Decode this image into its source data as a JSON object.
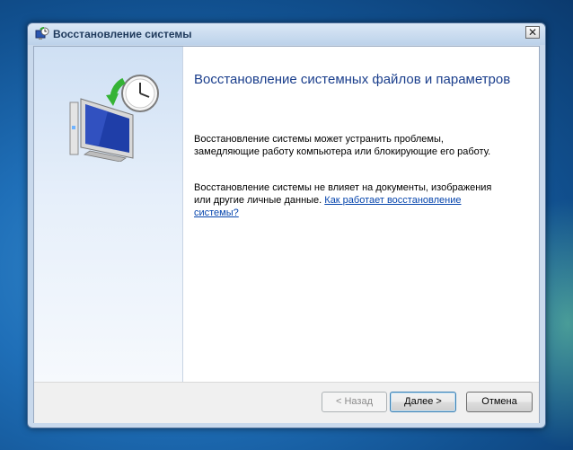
{
  "window": {
    "title": "Восстановление системы",
    "close_label": "✕"
  },
  "content": {
    "heading": "Восстановление системных файлов и параметров",
    "para1_line1": "Восстановление системы может устранить проблемы,",
    "para1_line2": "замедляющие работу компьютера или блокирующие его работу.",
    "para2_line1": "Восстановление системы не влияет на документы, изображения",
    "para2_line2_text": "или другие личные данные. ",
    "link_part1": "Как работает восстановление",
    "link_part2": "системы?"
  },
  "footer": {
    "back_label": "< Назад",
    "next_label": "Далее >",
    "cancel_label": "Отмена"
  },
  "icons": {
    "title": "system-restore-icon",
    "hero": "system-restore-monitor-clock-icon"
  },
  "colors": {
    "heading": "#1a3e8c",
    "link": "#0645ad",
    "title_text": "#1e395b"
  }
}
